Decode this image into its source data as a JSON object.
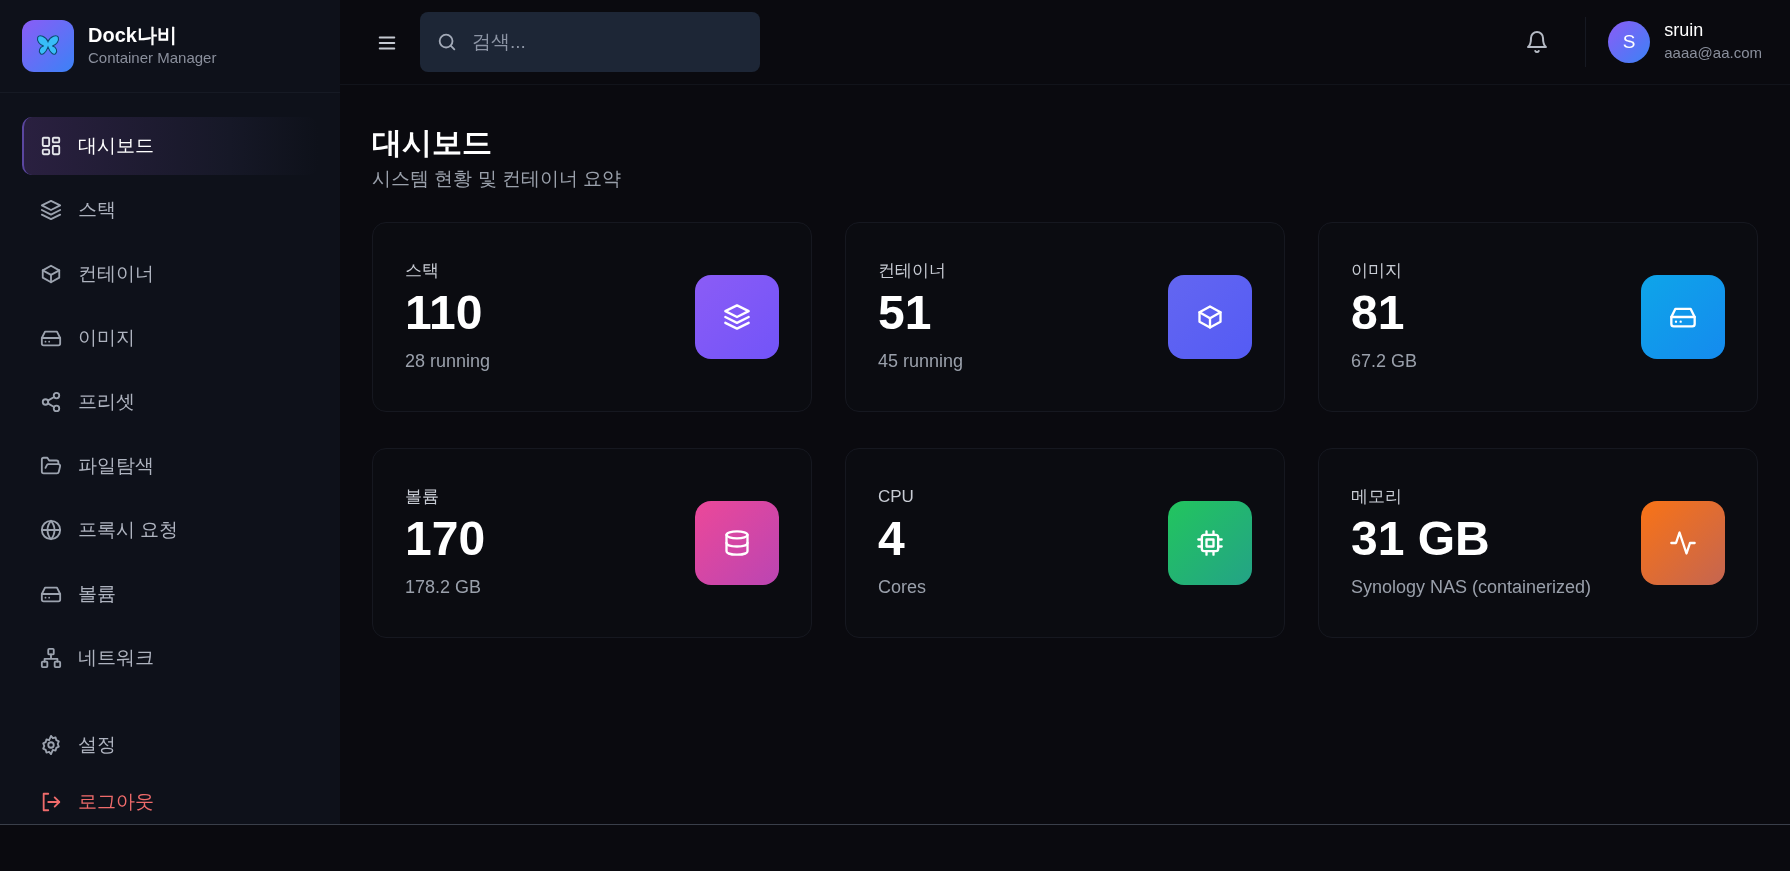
{
  "brand": {
    "name": "Dock나비",
    "subtitle": "Container Manager"
  },
  "sidebar": {
    "items": [
      {
        "label": "대시보드",
        "selected": true
      },
      {
        "label": "스택",
        "selected": false
      },
      {
        "label": "컨테이너",
        "selected": false
      },
      {
        "label": "이미지",
        "selected": false
      },
      {
        "label": "프리셋",
        "selected": false
      },
      {
        "label": "파일탐색",
        "selected": false
      },
      {
        "label": "프록시 요청",
        "selected": false
      },
      {
        "label": "볼륨",
        "selected": false
      },
      {
        "label": "네트워크",
        "selected": false
      }
    ],
    "bottom_items": [
      {
        "label": "설정",
        "kind": "settings"
      },
      {
        "label": "로그아웃",
        "kind": "logout"
      }
    ]
  },
  "topbar": {
    "search": {
      "placeholder": "검색..."
    },
    "user": {
      "initial": "S",
      "name": "sruin",
      "email": "aaaa@aa.com"
    }
  },
  "page": {
    "title": "대시보드",
    "subtitle": "시스템 현황 및 컨테이너 요약"
  },
  "stats": [
    {
      "label": "스택",
      "value": "110",
      "detail": "28 running",
      "color": "#8b5cf6"
    },
    {
      "label": "컨테이너",
      "value": "51",
      "detail": "45 running",
      "color": "#6366f1"
    },
    {
      "label": "이미지",
      "value": "81",
      "detail": "67.2 GB",
      "color": "#0ea5e9"
    },
    {
      "label": "볼륨",
      "value": "170",
      "detail": "178.2 GB",
      "color": "#ec4899"
    },
    {
      "label": "CPU",
      "value": "4",
      "detail": "Cores",
      "color": "#22c55e"
    },
    {
      "label": "메모리",
      "value": "31 GB",
      "detail": "Synology NAS (containerized)",
      "color": "#f97316"
    }
  ]
}
